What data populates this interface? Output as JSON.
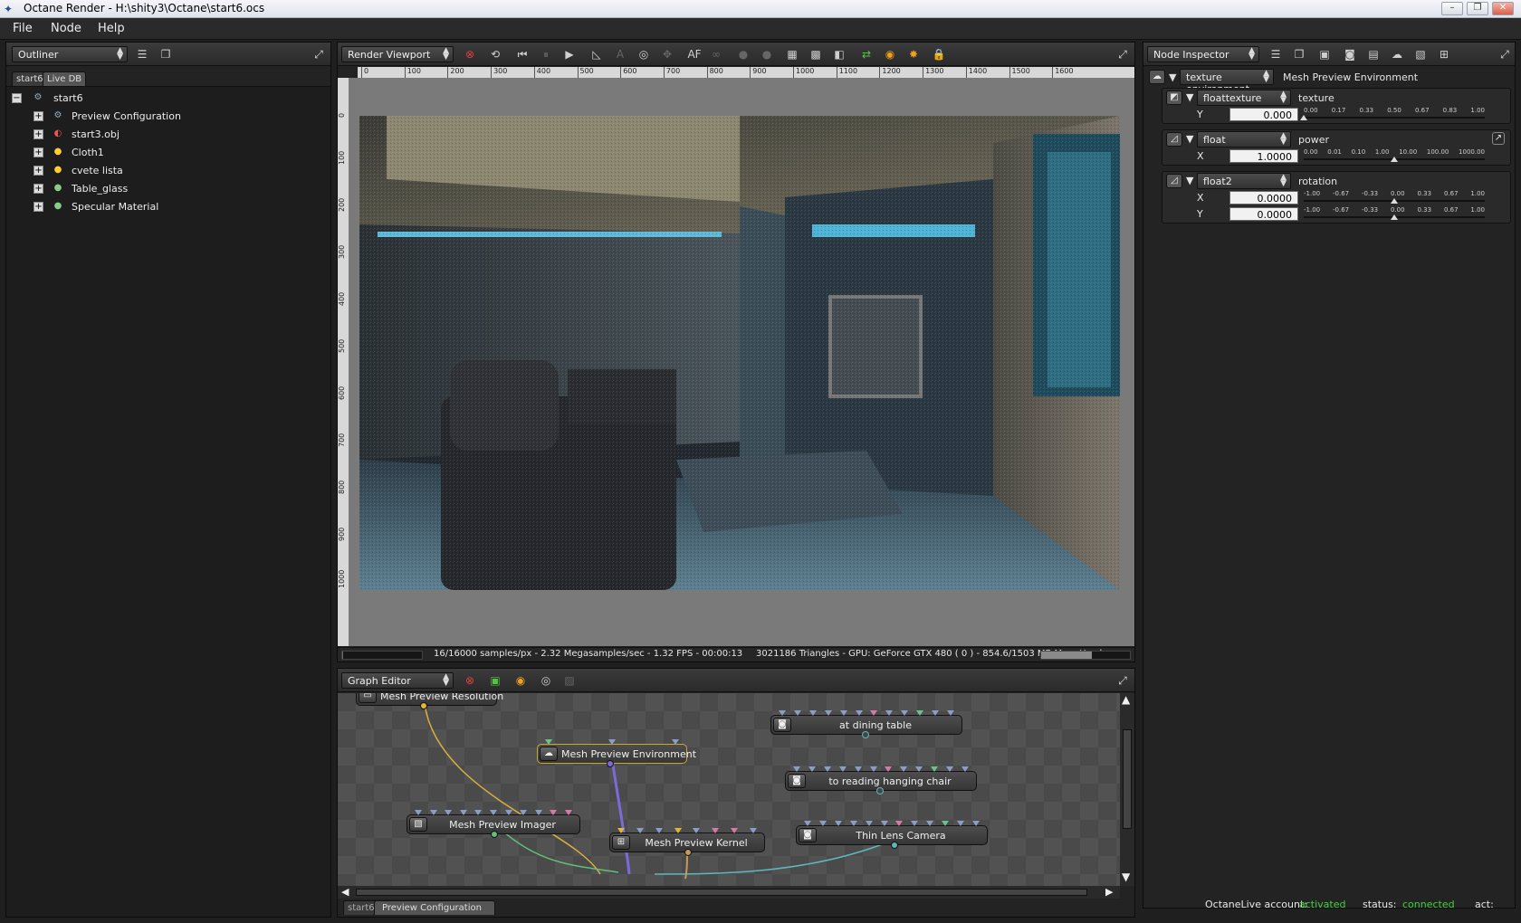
{
  "window": {
    "title": "Octane Render - H:\\shity3\\Octane\\start6.ocs",
    "buttons": [
      "minimize",
      "restore",
      "close"
    ]
  },
  "menu": [
    "File",
    "Node",
    "Help"
  ],
  "outliner": {
    "combo": "Outliner",
    "tabs": [
      "start6",
      "Live DB"
    ],
    "root": "start6",
    "items": [
      {
        "label": "Preview Configuration",
        "icon": "config-icon"
      },
      {
        "label": "start3.obj",
        "icon": "mesh-icon"
      },
      {
        "label": "Cloth1",
        "icon": "material-icon"
      },
      {
        "label": "cvete lista",
        "icon": "material-icon"
      },
      {
        "label": "Table_glass",
        "icon": "sphere-icon"
      },
      {
        "label": "Specular Material",
        "icon": "sphere-icon"
      }
    ]
  },
  "viewport": {
    "combo": "Render Viewport",
    "ruler_top": [
      "0",
      "100",
      "200",
      "300",
      "400",
      "500",
      "600",
      "700",
      "800",
      "900",
      "1000",
      "1100",
      "1200",
      "1300",
      "1400",
      "1500",
      "1600"
    ],
    "ruler_left": [
      "0",
      "100",
      "200",
      "300",
      "400",
      "500",
      "600",
      "700",
      "800",
      "900",
      "1000"
    ],
    "status_left": "16/16000 samples/px - 2.32 Megasamples/sec - 1.32 FPS - 00:00:13",
    "status_right": "3021186 Triangles - GPU: GeForce GTX 480 ( 0 ) - 854.6/1503 MB Mem Used",
    "progress": 0.001,
    "mem_used_fraction": 0.57
  },
  "graph": {
    "combo": "Graph Editor",
    "nodes": [
      {
        "label": "Mesh Preview Resolution"
      },
      {
        "label": "Mesh Preview Environment"
      },
      {
        "label": "Mesh Preview Imager"
      },
      {
        "label": "Mesh Preview Kernel"
      },
      {
        "label": "at dining table"
      },
      {
        "label": "to reading hanging chair"
      },
      {
        "label": "Thin Lens Camera"
      }
    ],
    "bottom_tabs": [
      "start6",
      "Preview Configuration"
    ]
  },
  "inspector": {
    "combo": "Node Inspector",
    "header": {
      "type": "texture environment",
      "name": "Mesh Preview Environment"
    },
    "rows": [
      {
        "type": "floattexture",
        "name": "texture",
        "fields": [
          {
            "axis": "Y",
            "value": "0.000"
          }
        ],
        "ticks": [
          "0.00",
          "0.17",
          "0.33",
          "0.50",
          "0.67",
          "0.83",
          "1.00"
        ],
        "knob": 0.0
      },
      {
        "type": "float",
        "name": "power",
        "fields": [
          {
            "axis": "X",
            "value": "1.0000"
          }
        ],
        "ticks": [
          "0.00",
          "0.01",
          "0.10",
          "1.00",
          "10.00",
          "100.00",
          "1000.00"
        ],
        "knob": 0.5
      },
      {
        "type": "float2",
        "name": "rotation",
        "fields": [
          {
            "axis": "X",
            "value": "0.0000"
          },
          {
            "axis": "Y",
            "value": "0.0000"
          }
        ],
        "ticks": [
          "-1.00",
          "-0.67",
          "-0.33",
          "0.00",
          "0.33",
          "0.67",
          "1.00"
        ],
        "knob": 0.5
      }
    ]
  },
  "statusbar": {
    "account_label": "OctaneLive account:",
    "account_value": "activated",
    "status_label": "status:",
    "status_value": "connected",
    "act_label": "act:"
  },
  "colors": {
    "accent_green": "#3fd23f",
    "render_frame": "#777777"
  }
}
